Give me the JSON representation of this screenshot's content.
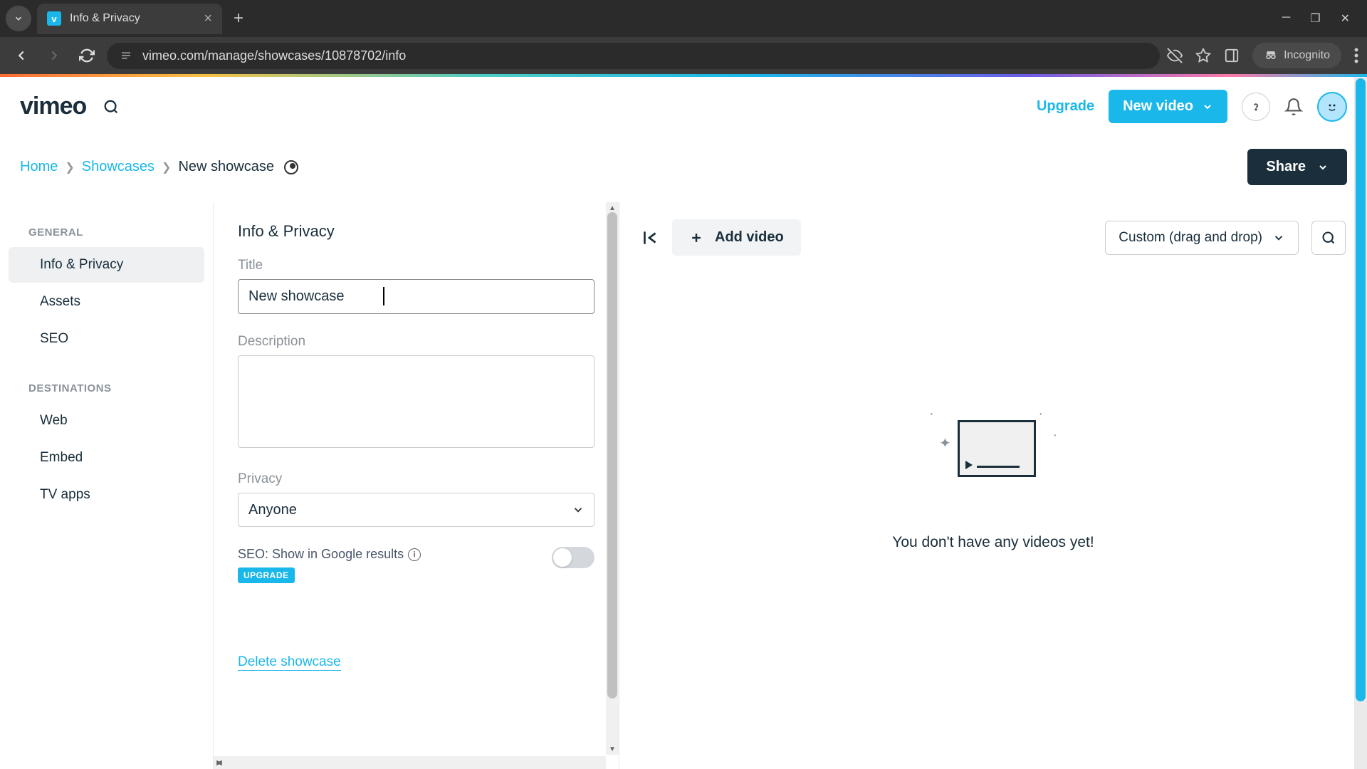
{
  "browser": {
    "tab_title": "Info & Privacy",
    "url": "vimeo.com/manage/showcases/10878702/info",
    "incognito_label": "Incognito"
  },
  "header": {
    "logo_text": "vimeo",
    "upgrade_label": "Upgrade",
    "new_video_label": "New video"
  },
  "breadcrumb": {
    "home": "Home",
    "showcases": "Showcases",
    "current": "New showcase",
    "share_label": "Share"
  },
  "sidebar": {
    "section1_header": "GENERAL",
    "section2_header": "DESTINATIONS",
    "items1": [
      {
        "label": "Info & Privacy",
        "active": true
      },
      {
        "label": "Assets",
        "active": false
      },
      {
        "label": "SEO",
        "active": false
      }
    ],
    "items2": [
      {
        "label": "Web"
      },
      {
        "label": "Embed"
      },
      {
        "label": "TV apps"
      }
    ]
  },
  "form": {
    "panel_title": "Info & Privacy",
    "title_label": "Title",
    "title_value": "New showcase",
    "description_label": "Description",
    "description_value": "",
    "privacy_label": "Privacy",
    "privacy_value": "Anyone",
    "seo_text": "SEO: Show in Google results",
    "upgrade_badge": "UPGRADE",
    "delete_label": "Delete showcase"
  },
  "right": {
    "add_video_label": "Add video",
    "sort_label": "Custom (drag and drop)",
    "empty_text": "You don't have any videos yet!"
  }
}
